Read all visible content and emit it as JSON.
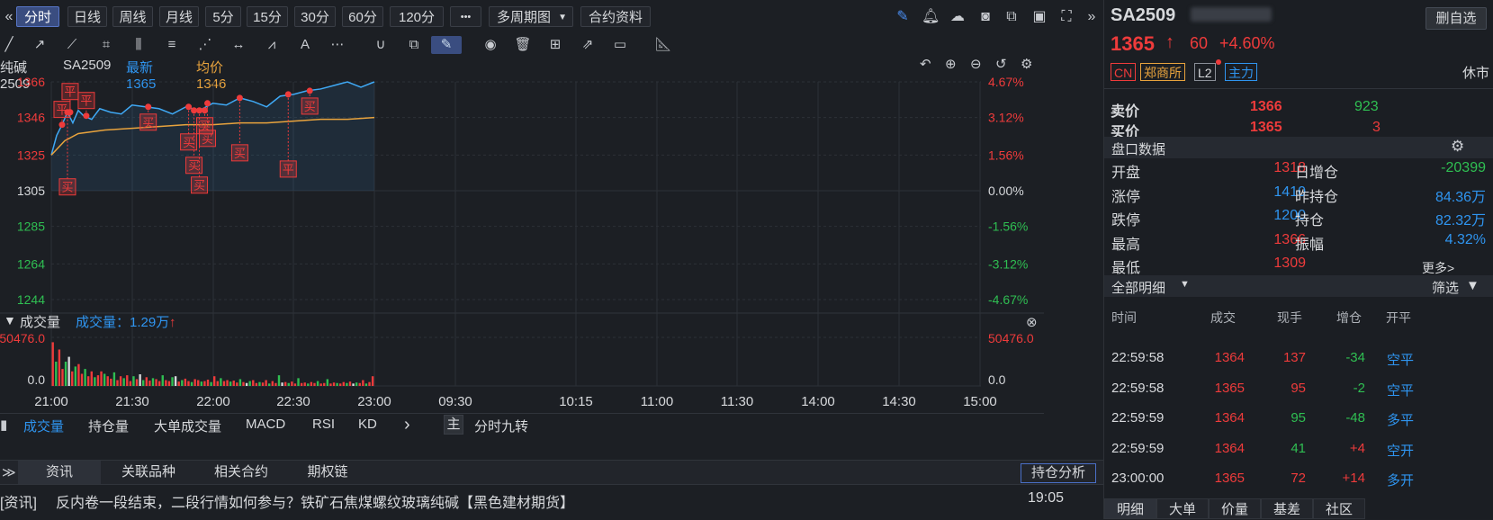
{
  "toolbar": {
    "periods": [
      "分时",
      "日线",
      "周线",
      "月线",
      "5分",
      "15分",
      "30分",
      "60分",
      "120分"
    ],
    "active_period": "分时",
    "more_label": "•••",
    "multi_period_label": "多周期图",
    "contract_info_label": "合约资料"
  },
  "chart_info": {
    "name": "纯碱2509",
    "code": "SA2509",
    "latest_label": "最新1365",
    "avg_label": "均价1346"
  },
  "chart_data": {
    "type": "line",
    "y_left_ticks": [
      "1366",
      "1346",
      "1325",
      "1305",
      "1285",
      "1264",
      "1244"
    ],
    "y_right_ticks": [
      "4.67%",
      "3.12%",
      "1.56%",
      "0.00%",
      "-1.56%",
      "-3.12%",
      "-4.67%"
    ],
    "x_ticks": [
      "21:00",
      "21:30",
      "22:00",
      "22:30",
      "23:00",
      "09:30",
      "10:15",
      "11:00",
      "11:30",
      "14:00",
      "14:30",
      "15:00"
    ],
    "ylim": [
      1244,
      1366
    ],
    "prev_close": 1305,
    "series": [
      {
        "name": "最新",
        "color": "#3fa9f5",
        "x": [
          0,
          2,
          4,
          6,
          8,
          10,
          12,
          15,
          18,
          22,
          26,
          30,
          35,
          40,
          45,
          50,
          55,
          60,
          65,
          70,
          75,
          80,
          85,
          90,
          95,
          100,
          105,
          110,
          115,
          120
        ],
        "values": [
          1325,
          1336,
          1342,
          1349,
          1343,
          1350,
          1347,
          1345,
          1351,
          1349,
          1348,
          1353,
          1352,
          1351,
          1348,
          1352,
          1350,
          1354,
          1353,
          1357,
          1355,
          1352,
          1358,
          1359,
          1361,
          1362,
          1364,
          1366,
          1363,
          1366
        ]
      },
      {
        "name": "均价",
        "color": "#e8a33d",
        "x": [
          0,
          5,
          10,
          20,
          30,
          40,
          50,
          60,
          70,
          80,
          90,
          100,
          110,
          120
        ],
        "values": [
          1325,
          1333,
          1337,
          1339,
          1340,
          1341,
          1342,
          1342,
          1343,
          1343,
          1344,
          1345,
          1345,
          1346
        ]
      }
    ],
    "markers": [
      {
        "x": 4,
        "label": "平"
      },
      {
        "x": 7,
        "label": "平"
      },
      {
        "x": 13,
        "label": "平"
      },
      {
        "x": 6,
        "label": "买"
      },
      {
        "x": 36,
        "label": "买"
      },
      {
        "x": 51,
        "label": "买"
      },
      {
        "x": 53,
        "label": "买"
      },
      {
        "x": 55,
        "label": "买"
      },
      {
        "x": 57,
        "label": "买"
      },
      {
        "x": 58,
        "label": "买"
      },
      {
        "x": 70,
        "label": "买"
      },
      {
        "x": 88,
        "label": "平"
      },
      {
        "x": 96,
        "label": "买"
      }
    ]
  },
  "volume": {
    "title": "成交量",
    "label": "成交量：1.29万",
    "arrow": "↑",
    "top_label": "50476.0",
    "bottom_label": "0.0",
    "values": [
      0.9,
      0.5,
      0.75,
      0.35,
      0.5,
      0.6,
      0.3,
      0.4,
      0.45,
      0.25,
      0.35,
      0.2,
      0.3,
      0.18,
      0.22,
      0.3,
      0.25,
      0.2,
      0.15,
      0.28,
      0.12,
      0.2,
      0.16,
      0.22,
      0.1,
      0.2,
      0.14,
      0.24,
      0.12,
      0.18,
      0.11,
      0.16,
      0.14,
      0.1,
      0.22,
      0.12,
      0.1,
      0.18,
      0.2,
      0.09,
      0.12,
      0.15,
      0.1,
      0.08,
      0.14,
      0.12,
      0.09,
      0.1,
      0.13,
      0.08,
      0.2,
      0.1,
      0.16,
      0.1,
      0.12,
      0.09,
      0.11,
      0.07,
      0.14,
      0.08,
      0.06,
      0.1,
      0.12,
      0.06,
      0.08,
      0.07,
      0.12,
      0.05,
      0.1,
      0.06,
      0.22,
      0.07,
      0.08,
      0.06,
      0.09,
      0.05,
      0.16,
      0.06,
      0.07,
      0.05,
      0.08,
      0.06,
      0.1,
      0.05,
      0.06,
      0.14,
      0.05,
      0.07,
      0.06,
      0.05,
      0.08,
      0.06,
      0.09,
      0.05,
      0.07,
      0.06,
      0.12,
      0.05,
      0.08,
      0.2
    ]
  },
  "indicator_tabs": [
    "成交量",
    "持仓量",
    "大单成交量",
    "MACD",
    "RSI",
    "KD"
  ],
  "indicator_more": "›",
  "main_label": "主",
  "nine_turn_label": "分时九转",
  "news_tabs": [
    "资讯",
    "关联品种",
    "相关合约",
    "期权链"
  ],
  "position_analysis_label": "持仓分析",
  "news": {
    "prefix": "[资讯]",
    "headline": "反内卷一段结束，二段行情如何参与？铁矿石焦煤螺纹玻璃纯碱【黑色建材期货】",
    "time": "19:05"
  },
  "right_panel": {
    "symbol": "SA2509",
    "delete_label": "删自选",
    "price": "1365",
    "arrow": "↑",
    "change": "60",
    "change_pct": "+4.60%",
    "tags": [
      "CN",
      "郑商所",
      "L2",
      "主力"
    ],
    "status": "休市",
    "ask_label": "卖价",
    "ask_price": "1366",
    "ask_vol": "923",
    "bid_label": "买价",
    "bid_price": "1365",
    "bid_vol": "3",
    "panel_title": "盘口数据",
    "quotes": [
      {
        "l1": "开盘",
        "v1": "1318",
        "l2": "日增仓",
        "v2": "-20399"
      },
      {
        "l1": "涨停",
        "v1": "1410",
        "l2": "昨持仓",
        "v2": "84.36万"
      },
      {
        "l1": "跌停",
        "v1": "1200",
        "l2": "持仓",
        "v2": "82.32万"
      },
      {
        "l1": "最高",
        "v1": "1366",
        "l2": "振幅",
        "v2": "4.32%"
      },
      {
        "l1": "最低",
        "v1": "1309",
        "l2": "",
        "v2": ""
      }
    ],
    "more_label": "更多>",
    "detail_title": "全部明细",
    "filter_label": "筛选",
    "detail_headers": [
      "时间",
      "成交",
      "现手",
      "增仓",
      "开平"
    ],
    "details": [
      {
        "time": "22:59:58",
        "price": "1364",
        "vol": "137",
        "oi": "-34",
        "type": "空平"
      },
      {
        "time": "22:59:58",
        "price": "1365",
        "vol": "95",
        "oi": "-2",
        "type": "空平"
      },
      {
        "time": "22:59:59",
        "price": "1364",
        "vol": "95",
        "oi": "-48",
        "type": "多平"
      },
      {
        "time": "22:59:59",
        "price": "1364",
        "vol": "41",
        "oi": "+4",
        "type": "空开"
      },
      {
        "time": "23:00:00",
        "price": "1365",
        "vol": "72",
        "oi": "+14",
        "type": "多开"
      }
    ],
    "bottom_tabs": [
      "明细",
      "大单",
      "价量",
      "基差",
      "社区"
    ]
  }
}
